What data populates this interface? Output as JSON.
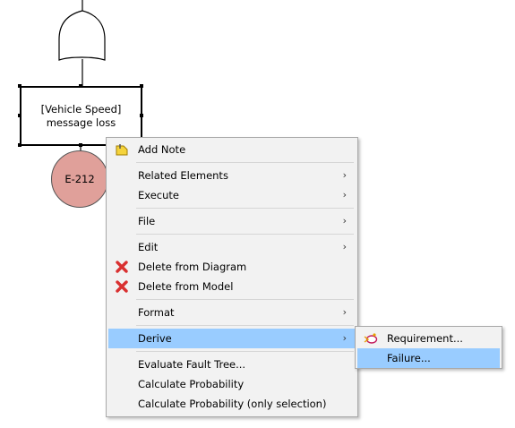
{
  "diagram": {
    "node": {
      "line1": "[Vehicle Speed]",
      "line2": "message loss"
    },
    "event": {
      "label": "E-212",
      "color": "#e0a09a"
    }
  },
  "context_menu": {
    "items": [
      {
        "label": "Add Note",
        "icon": "note-icon"
      },
      {
        "label": "Related Elements",
        "submenu": true
      },
      {
        "label": "Execute",
        "submenu": true
      },
      {
        "label": "File",
        "submenu": true
      },
      {
        "label": "Edit",
        "submenu": true
      },
      {
        "label": "Delete from Diagram",
        "icon": "red-x-icon"
      },
      {
        "label": "Delete from Model",
        "icon": "red-x-icon"
      },
      {
        "label": "Format",
        "submenu": true
      },
      {
        "label": "Derive",
        "submenu": true,
        "highlighted": true
      },
      {
        "label": "Evaluate Fault Tree..."
      },
      {
        "label": "Calculate Probability"
      },
      {
        "label": "Calculate Probability (only selection)"
      }
    ],
    "submenu_arrow": "›",
    "highlight_color": "#99ccff"
  },
  "derive_submenu": {
    "items": [
      {
        "label": "Requirement...",
        "icon": "requirement-icon"
      },
      {
        "label": "Failure...",
        "highlighted": true
      }
    ]
  }
}
